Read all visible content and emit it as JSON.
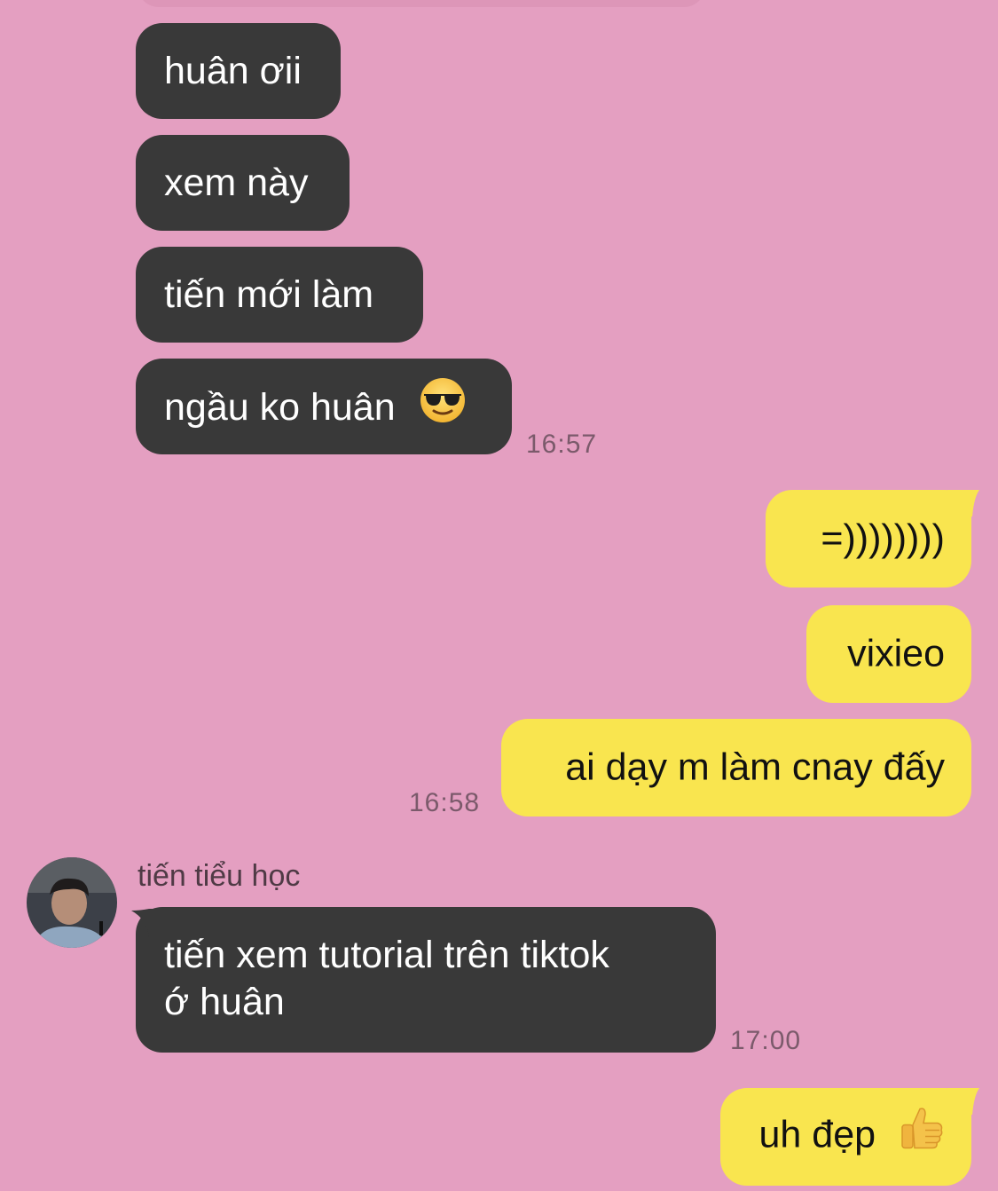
{
  "incoming": [
    {
      "text": "huân ơii"
    },
    {
      "text": "xem này"
    },
    {
      "text": "tiến mới làm"
    },
    {
      "text": "ngầu ko huân",
      "emoji": "sunglasses-face-emoji"
    },
    {
      "line1": "tiến xem tutorial trên tiktok",
      "line2": "ớ huân"
    }
  ],
  "outgoing": [
    {
      "text": "=))))))))"
    },
    {
      "text": "vixieo"
    },
    {
      "text": "ai dạy m làm cnay đấy"
    },
    {
      "text": "uh đẹp",
      "emoji": "thumbs-up-emoji"
    }
  ],
  "timestamps": {
    "first": "16:57",
    "second": "16:58",
    "third": "17:00"
  },
  "sender_name": "tiến tiểu học",
  "colors": {
    "background": "#e49fc1",
    "incoming_bubble": "#393939",
    "outgoing_bubble": "#f9e54f",
    "timestamp": "#7b5a6b"
  }
}
